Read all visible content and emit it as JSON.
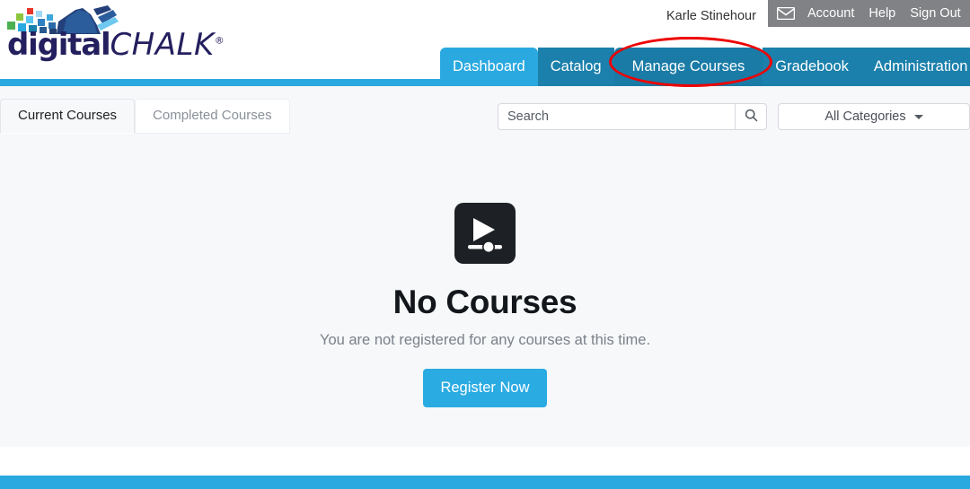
{
  "header": {
    "logo": {
      "word_primary": "digital",
      "word_secondary": "CHALK",
      "trademark": "®"
    },
    "user_name": "Karle Stinehour",
    "utility_links": [
      {
        "name": "mail-icon",
        "label": ""
      },
      {
        "name": "account",
        "label": "Account"
      },
      {
        "name": "help",
        "label": "Help"
      },
      {
        "name": "signout",
        "label": "Sign Out"
      }
    ]
  },
  "nav": {
    "items": [
      {
        "label": "Dashboard",
        "state": "active"
      },
      {
        "label": "Catalog",
        "state": "default"
      },
      {
        "label": "Manage Courses",
        "state": "highlight"
      },
      {
        "label": "Gradebook",
        "state": "default"
      },
      {
        "label": "Administration",
        "state": "default"
      }
    ],
    "annotation": "red-ellipse-around-manage-courses"
  },
  "toolbar": {
    "tabs": [
      {
        "label": "Current Courses",
        "state": "active"
      },
      {
        "label": "Completed Courses",
        "state": "inactive"
      }
    ],
    "search": {
      "value": "",
      "placeholder": "Search",
      "button_icon": "search-icon"
    },
    "category_filter": {
      "selected": "All Categories",
      "options": [
        "All Categories"
      ]
    }
  },
  "empty_state": {
    "icon": "video-course-icon",
    "title": "No Courses",
    "subtitle": "You are not registered for any courses at this time.",
    "cta_label": "Register Now"
  },
  "colors": {
    "brand_blue": "#2aa9e0",
    "nav_blue_dark": "#1b80ab",
    "nav_blue_highlight": "#1a7ba6",
    "utility_gray": "#808285",
    "content_bg": "#f7f8fa",
    "annotation_red": "#ee0000",
    "logo_navy": "#241f5e",
    "icon_dark": "#1d2125"
  }
}
